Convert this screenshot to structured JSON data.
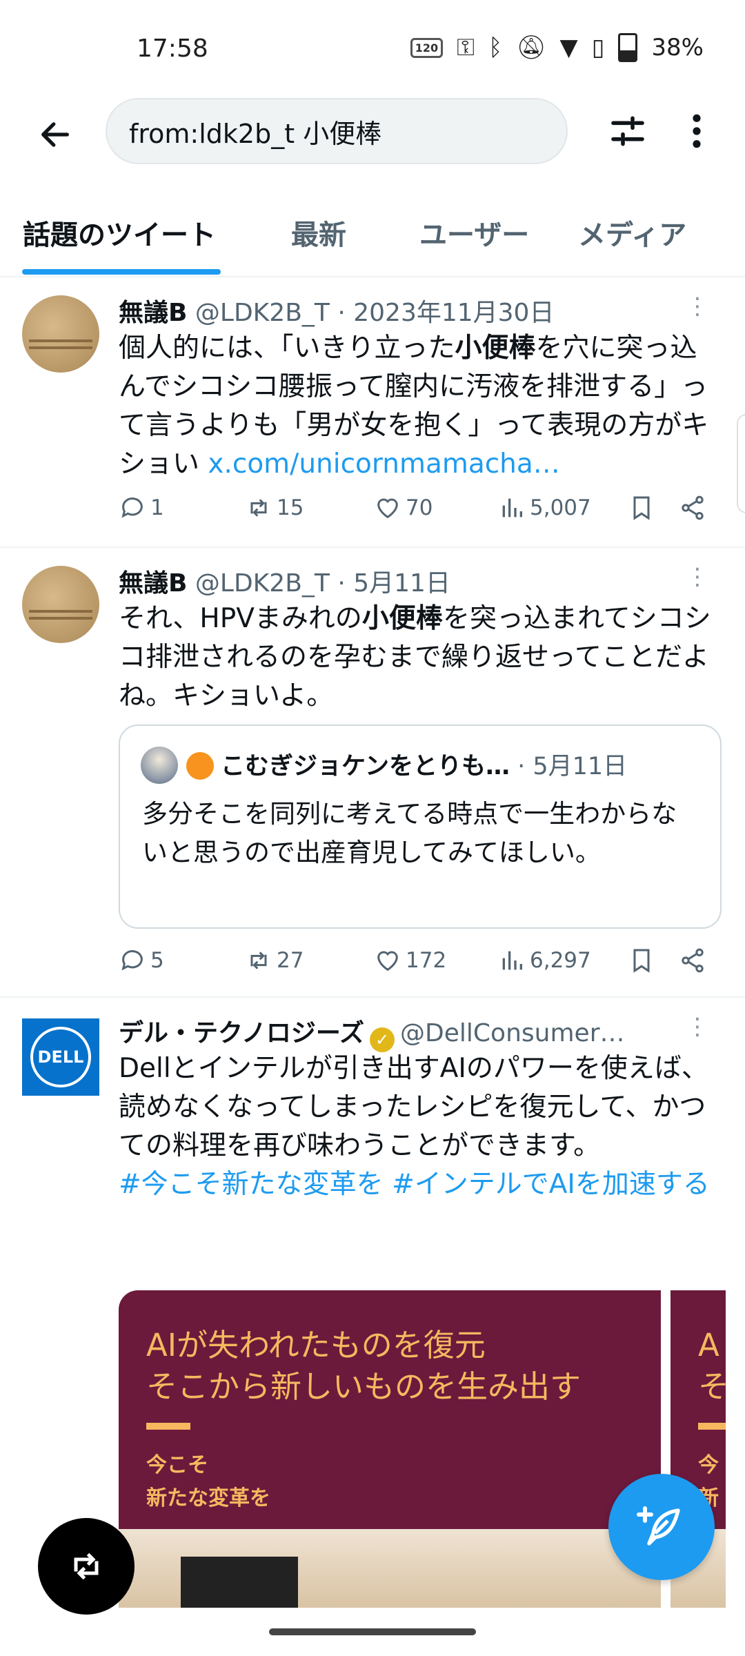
{
  "status_bar": {
    "time": "17:58",
    "refresh_rate": "120",
    "battery": "38%"
  },
  "search": {
    "query": "from:ldk2b_t 小便棒"
  },
  "tabs": [
    {
      "label": "話題のツイート",
      "active": true
    },
    {
      "label": "最新"
    },
    {
      "label": "ユーザー"
    },
    {
      "label": "メディア"
    }
  ],
  "tweets": [
    {
      "name": "無議B",
      "handle": "@LDK2B_T",
      "date": "· 2023年11月30日",
      "text_1": "個人的には、「いきり立った",
      "text_bold": "小便棒",
      "text_2": "を穴に突っ込んでシコシコ腰振って膣内に汚液を排泄する」って言うよりも「男が女を抱く」って表現の方がキショい ",
      "link": "x.com/unicornmamacha…",
      "replies": "1",
      "retweets": "15",
      "likes": "70",
      "views": "5,007"
    },
    {
      "name": "無議B",
      "handle": "@LDK2B_T",
      "date": "· 5月11日",
      "text_1": "それ、HPVまみれの",
      "text_bold": "小便棒",
      "text_2": "を突っ込まれてシコシコ排泄されるのを孕むまで繰り返せってことだよね。キショいよ。",
      "quote": {
        "name": "こむぎジョケンをとりも…",
        "date": "· 5月11日",
        "text": "多分そこを同列に考えてる時点で一生わからないと思うので出産育児してみてほしい。"
      },
      "replies": "5",
      "retweets": "27",
      "likes": "172",
      "views": "6,297"
    },
    {
      "name": "デル・テクノロジーズ",
      "handle": "@DellConsumer…",
      "logo_text": "DELL",
      "text": "Dellとインテルが引き出すAIのパワーを使えば、読めなくなってしまったレシピを復元して、かつての料理を再び味わうことができます。",
      "hashtags": "#今こそ新たな変革を #インテルでAIを加速する",
      "card": {
        "headline_1": "AIが失われたものを復元",
        "headline_2": "そこから新しいものを生み出す",
        "sub_1": "今こそ",
        "sub_2": "新たな変革を"
      },
      "card2": {
        "headline_1": "A",
        "headline_2": "そ",
        "sub_1": "今",
        "sub_2": "新"
      }
    }
  ],
  "colors": {
    "accent": "#1d9bf0",
    "card_bg": "#6b1a3c",
    "card_text": "#f6b85f"
  }
}
